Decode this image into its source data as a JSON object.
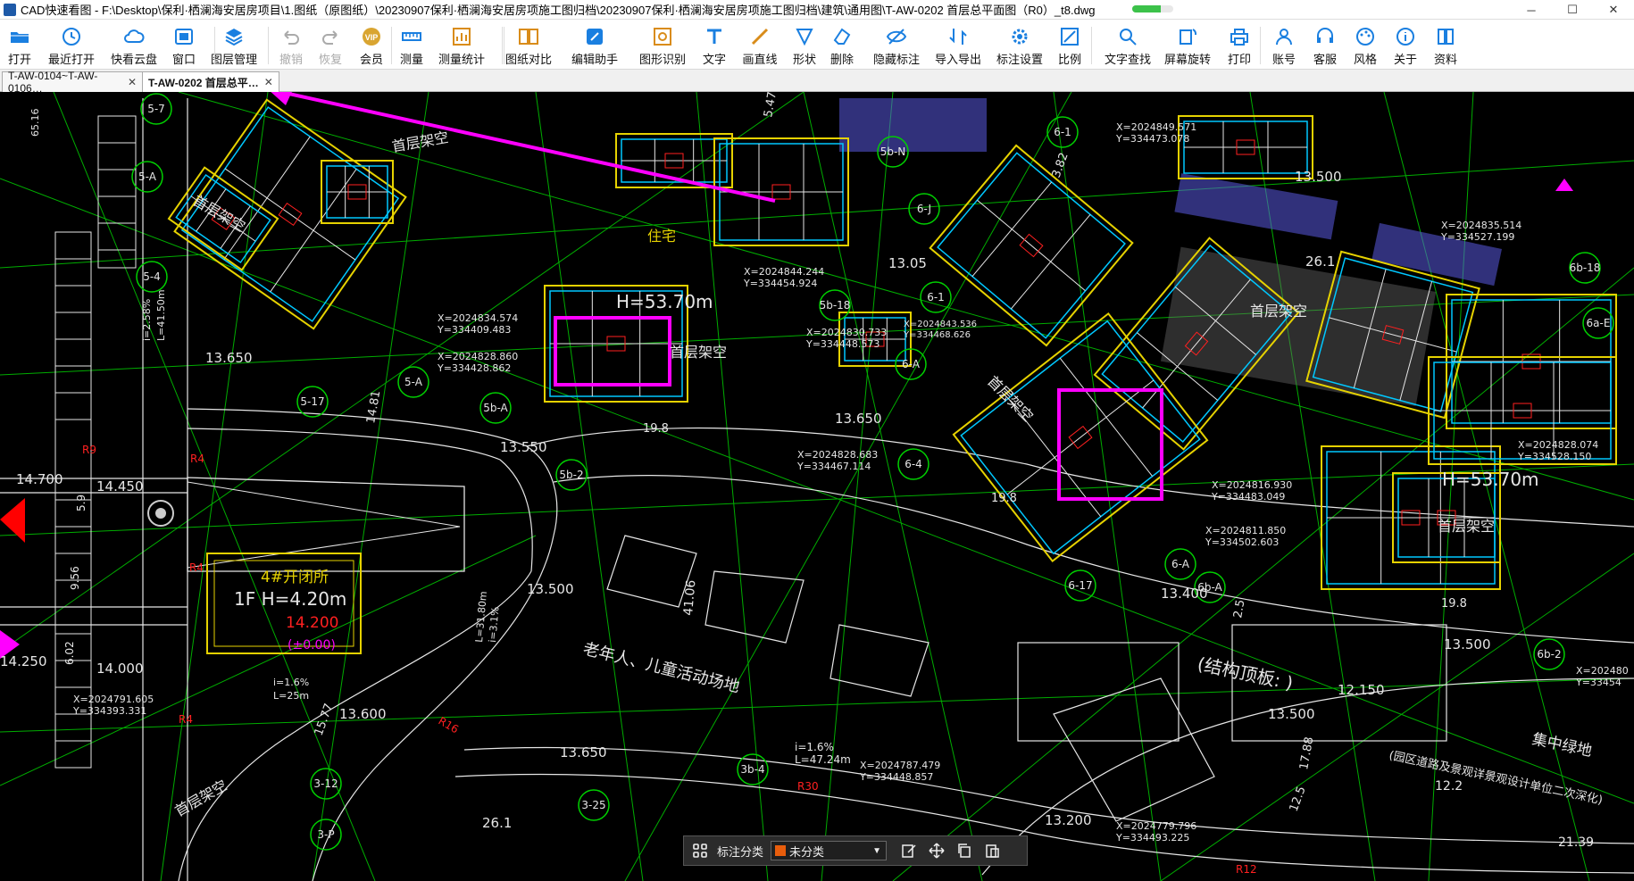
{
  "window": {
    "title": "CAD快速看图 - F:\\Desktop\\保利·栖澜海安居房项目\\1.图纸（原图纸）\\20230907保利·栖澜海安居房项施工图归档\\20230907保利·栖澜海安居房项施工图归档\\建筑\\通用图\\T-AW-0202 首层总平面图（R0）_t8.dwg",
    "progress": 0.7,
    "minimize": "─",
    "maximize": "☐",
    "close": "✕"
  },
  "toolbar": {
    "items": [
      {
        "label": "打开",
        "icon": "folder-open-icon",
        "enabled": true
      },
      {
        "label": "最近打开",
        "icon": "clock-icon",
        "enabled": true
      },
      {
        "label": "快看云盘",
        "icon": "cloud-icon",
        "enabled": true
      },
      {
        "label": "窗口",
        "icon": "window-icon",
        "enabled": true
      },
      {
        "label": "图层管理",
        "icon": "layers-icon",
        "enabled": true
      },
      {
        "label": "撤销",
        "icon": "undo-icon",
        "enabled": false
      },
      {
        "label": "恢复",
        "icon": "redo-icon",
        "enabled": false
      },
      {
        "label": "会员",
        "icon": "vip-icon",
        "enabled": true
      },
      {
        "label": "测量",
        "icon": "ruler-icon",
        "enabled": true
      },
      {
        "label": "测量统计",
        "icon": "measure-stats-icon",
        "enabled": true
      },
      {
        "label": "图纸对比",
        "icon": "compare-icon",
        "enabled": true
      },
      {
        "label": "编辑助手",
        "icon": "edit-assistant-icon",
        "enabled": true
      },
      {
        "label": "图形识别",
        "icon": "shape-recognize-icon",
        "enabled": true
      },
      {
        "label": "文字",
        "icon": "text-icon",
        "enabled": true
      },
      {
        "label": "画直线",
        "icon": "line-icon",
        "enabled": true
      },
      {
        "label": "形状",
        "icon": "shape-icon",
        "enabled": true
      },
      {
        "label": "删除",
        "icon": "eraser-icon",
        "enabled": true
      },
      {
        "label": "隐藏标注",
        "icon": "hide-eye-icon",
        "enabled": true
      },
      {
        "label": "导入导出",
        "icon": "import-export-icon",
        "enabled": true
      },
      {
        "label": "标注设置",
        "icon": "gear-icon",
        "enabled": true
      },
      {
        "label": "比例",
        "icon": "scale-icon",
        "enabled": true
      },
      {
        "label": "文字查找",
        "icon": "text-search-icon",
        "enabled": true
      },
      {
        "label": "屏幕旋转",
        "icon": "rotate-screen-icon",
        "enabled": true
      },
      {
        "label": "打印",
        "icon": "printer-icon",
        "enabled": true
      },
      {
        "label": "账号",
        "icon": "user-icon",
        "enabled": true
      },
      {
        "label": "客服",
        "icon": "headset-icon",
        "enabled": true
      },
      {
        "label": "风格",
        "icon": "palette-icon",
        "enabled": true
      },
      {
        "label": "关于",
        "icon": "info-icon",
        "enabled": true
      },
      {
        "label": "资料",
        "icon": "book-icon",
        "enabled": true
      }
    ]
  },
  "tabs": [
    {
      "label": "T-AW-0104~T-AW-0106…",
      "close": "✕",
      "active": false
    },
    {
      "label": "T-AW-0202 首层总平…",
      "close": "✕",
      "active": true
    }
  ],
  "drawing": {
    "colors": {
      "bg": "#000000",
      "road": "#e6e6e6",
      "grid": "#00d000",
      "building": "#e6d200",
      "wall": "#00c8ff",
      "annot": "#ff00ff",
      "red": "#ff2020"
    },
    "texts": {
      "t_1": "首层架空",
      "t_2": "首层架空",
      "t_3": "首层架空",
      "t_4": "首层架空",
      "t_5": "首层架空",
      "t_6": "首层架空",
      "t_7": "首层架空",
      "t_8": "住宅",
      "t_9": "H=53.70m",
      "t_10": "H=53.70m",
      "t_11": "13.650",
      "t_12": "13.550",
      "t_13": "13.650",
      "t_14": "14.700",
      "t_15": "14.450",
      "t_16": "14.250",
      "t_17": "14.000",
      "t_18": "13.500",
      "t_19": "13.500",
      "t_20": "13.400",
      "t_21": "13.500",
      "t_22": "13.500",
      "t_23": "13.05",
      "t_24": "13.600",
      "t_25": "13.650",
      "t_26": "13.200",
      "t_27": "12.150",
      "t_28": "4#开闭所",
      "t_29": "1F H=4.20m",
      "t_30": "14.200",
      "t_31": "(±0.00)",
      "t_32": "老年人、儿童活动场地",
      "t_33": "(结构顶板: )",
      "t_34": "集中绿地",
      "t_35": "(园区道路及景观详景观设计单位二次深化)",
      "t_36": "X=2024834.574",
      "t_37": "Y=334409.483",
      "t_38": "X=2024828.860",
      "t_39": "Y=334428.862",
      "t_40": "X=2024844.244",
      "t_41": "Y=334454.924",
      "t_42": "X=2024830.733",
      "t_43": "Y=334448.573",
      "t_44": "X=2024843.536",
      "t_45": "Y=334468.626",
      "t_46": "X=2024828.683",
      "t_47": "Y=334467.114",
      "t_48": "X=2024849.571",
      "t_49": "Y=334473.078",
      "t_50": "X=2024835.514",
      "t_51": "Y=334527.199",
      "t_52": "X=2024828.074",
      "t_53": "Y=334528.150",
      "t_54": "X=2024816.930",
      "t_55": "Y=334483.049",
      "t_56": "X=2024811.850",
      "t_57": "Y=334502.603",
      "t_58": "X=2024791.605",
      "t_59": "Y=334393.331",
      "t_60": "X=2024787.479",
      "t_61": "Y=334448.857",
      "t_62": "X=2024779.796",
      "t_63": "Y=334493.225",
      "t_64": "X=202480",
      "t_65": "Y=33454",
      "t_66": "5-7",
      "t_67": "5-A",
      "t_68": "5-4",
      "t_69": "5-17",
      "t_70": "5-A",
      "t_71": "5b-A",
      "t_72": "5b-2",
      "t_73": "5b-18",
      "t_74": "5b-N",
      "t_75": "6-1",
      "t_76": "6-J",
      "t_77": "6-A",
      "t_78": "6-4",
      "t_79": "6-1",
      "t_80": "6-17",
      "t_81": "6-A",
      "t_82": "6b-A",
      "t_83": "6b-2",
      "t_84": "6b-18",
      "t_85": "6a-E",
      "t_86": "3-12",
      "t_87": "3-P",
      "t_88": "3-25",
      "t_89": "3b-4",
      "t_90": "R9",
      "t_91": "R4",
      "t_92": "R4",
      "t_93": "R4",
      "t_94": "R16",
      "t_95": "R30",
      "t_96": "R12",
      "t_97": "26.1",
      "t_98": "26.1",
      "t_99": "19.8",
      "t_100": "19.8",
      "t_101": "19.8",
      "t_102": "21.39",
      "t_103": "12.2",
      "t_104": "41.06",
      "t_105": "i=1.6%",
      "t_106": "L=47.24m",
      "t_107": "i=1.6%",
      "t_108": "L=25m",
      "t_109": "i=2.58%",
      "t_110": "L=41.50m",
      "t_111": "5.9",
      "t_112": "9.56",
      "t_113": "6.02",
      "t_114": "65.16",
      "t_115": "3.82",
      "t_116": "5.47",
      "t_117": "15.77",
      "t_118": "14.81",
      "t_119": "12.5",
      "t_120": "2.5",
      "t_121": "17.88",
      "t_122": "L=31.80m",
      "t_123": "i=3.1%"
    }
  },
  "floatbar": {
    "label": "标注分类",
    "selected": "未分类",
    "swatch_color": "#e85d0c",
    "caret": "▼",
    "icons": [
      "grid-menu-icon",
      "edit-note-icon",
      "move-icon",
      "copy-icon",
      "paste-icon"
    ]
  }
}
